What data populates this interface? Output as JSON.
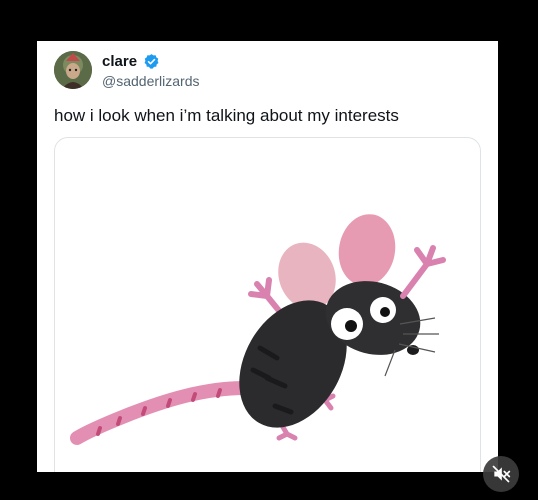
{
  "post": {
    "display_name": "clare",
    "handle": "@sadderlizards",
    "verified": true,
    "text": "how i look when i’m talking about my interests",
    "media": {
      "subject": "cartoon mouse illustration",
      "colors": {
        "body": "#2b2b2d",
        "ears": "#e8b4c0",
        "paws": "#d982b0",
        "tail": "#e38fb3"
      }
    }
  },
  "controls": {
    "mute_icon": "speaker-muted-icon"
  },
  "colors": {
    "page_background": "#000000",
    "card_background": "#ffffff",
    "verified_badge": "#1d9bf0",
    "name_text": "#0f1419",
    "handle_text": "#536471"
  }
}
